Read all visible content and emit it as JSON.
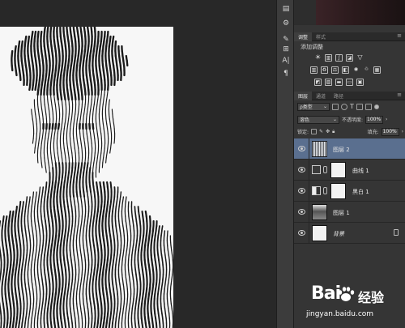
{
  "adjustments_panel": {
    "tabs": [
      "调整",
      "样式"
    ],
    "title": "添加调整",
    "row1_icons": [
      "brightness-icon",
      "levels-icon",
      "curves-icon",
      "exposure-icon",
      "triangle-icon"
    ],
    "row2_icons": [
      "vibrance-icon",
      "hue-icon",
      "color-balance-icon",
      "bw-icon",
      "photo-filter-icon",
      "channel-mixer-icon",
      "color-lookup-icon"
    ],
    "row3_icons": [
      "invert-icon",
      "posterize-icon",
      "threshold-icon",
      "gradient-map-icon",
      "selective-color-icon"
    ]
  },
  "layers_panel": {
    "tabs": [
      "图层",
      "通道",
      "路径"
    ],
    "filter_kind": "ρ类型",
    "blend_mode": "溶色",
    "opacity_label": "不透明度:",
    "opacity_value": "100%",
    "lock_label": "锁定:",
    "fill_label": "填充:",
    "fill_value": "100%",
    "layers": [
      {
        "name": "图层 2",
        "selected": true,
        "kind": "pixel"
      },
      {
        "name": "曲线 1",
        "selected": false,
        "kind": "adjustment"
      },
      {
        "name": "黑白 1",
        "selected": false,
        "kind": "adjustment"
      },
      {
        "name": "图层 1",
        "selected": false,
        "kind": "portrait"
      },
      {
        "name": "背景",
        "selected": false,
        "kind": "background"
      }
    ]
  },
  "tool_strip": {
    "text_tool": "A|",
    "paragraph_tool": "¶"
  },
  "watermark": {
    "logo": "Bai",
    "brand": "经验",
    "url": "jingyan.baidu.com"
  },
  "colors": {
    "selected_layer": "#5a6f8f",
    "panel_bg": "#353535",
    "canvas_bg": "#282828"
  }
}
